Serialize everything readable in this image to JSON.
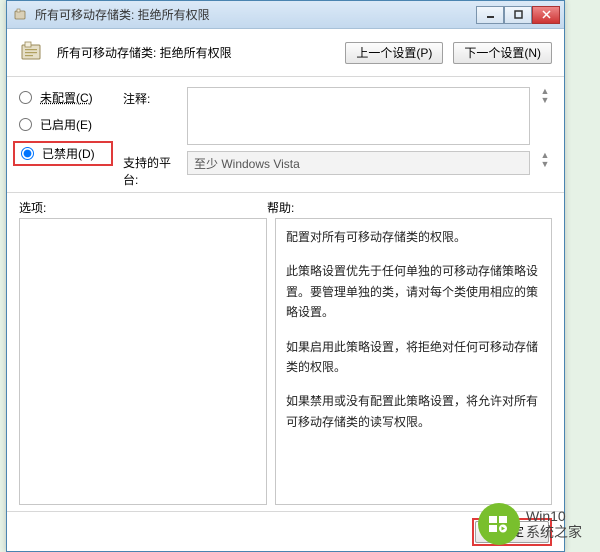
{
  "window": {
    "title": "所有可移动存储类: 拒绝所有权限",
    "min_tooltip": "最小化",
    "max_tooltip": "最大化",
    "close_tooltip": "关闭"
  },
  "header": {
    "title": "所有可移动存储类: 拒绝所有权限",
    "prev": "上一个设置(P)",
    "next": "下一个设置(N)"
  },
  "radios": {
    "not_configured": "未配置(C)",
    "enabled": "已启用(E)",
    "disabled": "已禁用(D)",
    "selected": "disabled"
  },
  "fields": {
    "comment_label": "注释:",
    "comment_value": "",
    "platform_label": "支持的平台:",
    "platform_value": "至少 Windows Vista"
  },
  "labels": {
    "options": "选项:",
    "help": "帮助:"
  },
  "help": {
    "p1": "配置对所有可移动存储类的权限。",
    "p2": "此策略设置优先于任何单独的可移动存储策略设置。要管理单独的类，请对每个类使用相应的策略设置。",
    "p3": "如果启用此策略设置，将拒绝对任何可移动存储类的权限。",
    "p4": "如果禁用或没有配置此策略设置，将允许对所有可移动存储类的读写权限。"
  },
  "footer": {
    "ok": "确定"
  },
  "watermark": {
    "line1": "Win10",
    "line2": "系统之家"
  }
}
